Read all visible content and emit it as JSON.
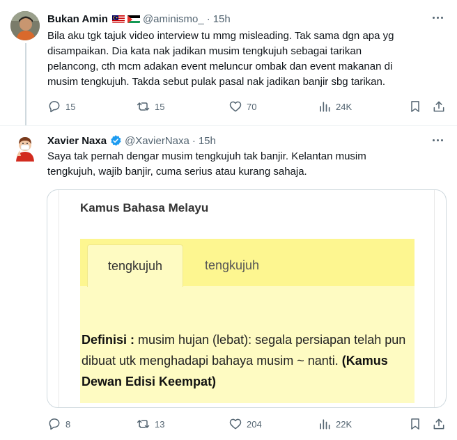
{
  "tweets": [
    {
      "author_name": "Bukan Amin",
      "flags": [
        "malaysia-flag",
        "palestine-flag"
      ],
      "handle": "@aminismo_",
      "separator": "·",
      "time": "15h",
      "text": "Bila aku tgk tajuk video interview tu mmg misleading. Tak sama dgn apa yg\ndisampaikan. Dia kata nak jadikan musim tengkujuh sebagai tarikan\npelancong, cth mcm adakan event meluncur ombak dan event makanan di\nmusim tengkujuh. Takda sebut pulak pasal nak jadikan banjir sbg tarikan.",
      "replies": "15",
      "reposts": "15",
      "likes": "70",
      "views": "24K"
    },
    {
      "author_name": "Xavier Naxa",
      "verified": true,
      "handle": "@XavierNaxa",
      "separator": "·",
      "time": "15h",
      "text": "Saya tak pernah dengar musim tengkujuh tak banjir.  Kelantan musim\ntengkujuh, wajib banjir, cuma serius atau kurang sahaja.",
      "card": {
        "title": "Kamus Bahasa Melayu",
        "tabs": [
          "tengkujuh",
          "tengkujuh"
        ],
        "definition_label": "Definisi :",
        "definition_text": " musim hujan (lebat): segala persiapan telah pun dibuat utk menghadapi bahaya musim ~ nanti. ",
        "definition_source": "(Kamus Dewan Edisi Keempat)"
      },
      "replies": "8",
      "reposts": "13",
      "likes": "204",
      "views": "22K"
    }
  ],
  "colors": {
    "text": "#0f1419",
    "secondary": "#536471",
    "verified": "#1d9bf0",
    "kamus_yellow": "#fefbc2",
    "kamus_tab_bar": "#fdf690"
  },
  "icons": [
    "reply-icon",
    "repost-icon",
    "like-icon",
    "views-icon",
    "bookmark-icon",
    "share-icon",
    "more-icon",
    "verified-badge-icon"
  ]
}
